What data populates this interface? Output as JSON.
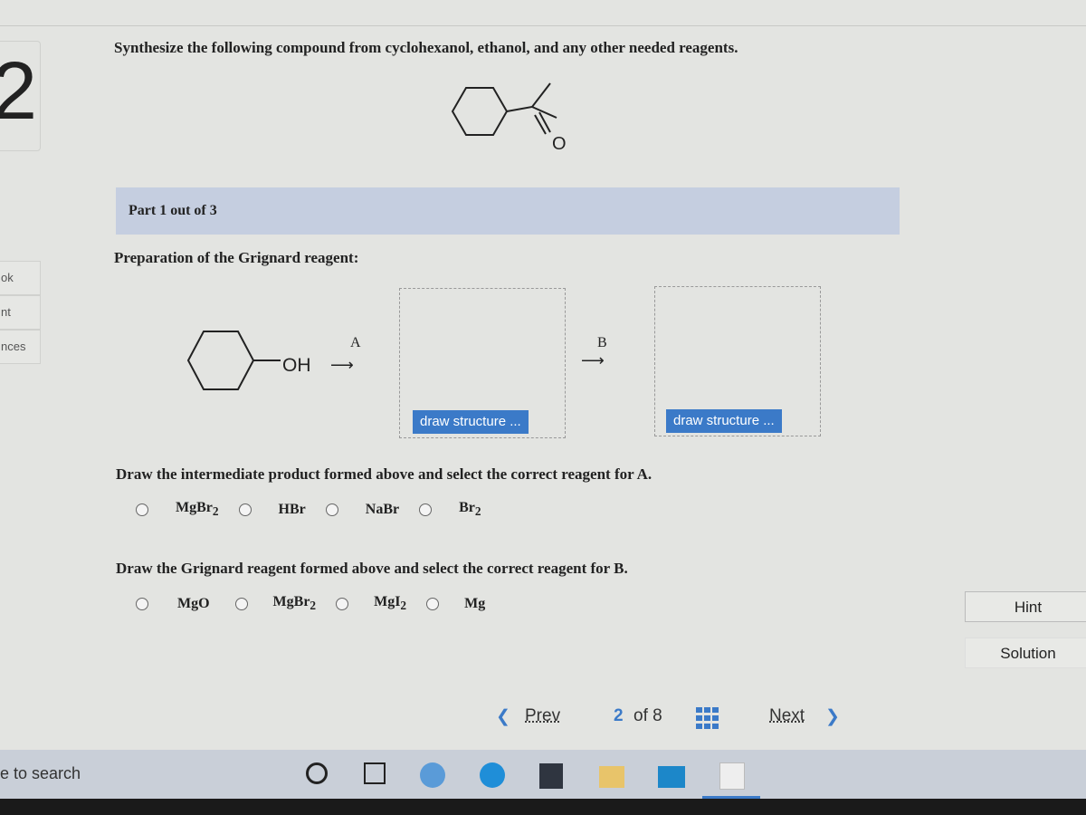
{
  "question": {
    "number": "2",
    "prompt": "Synthesize the following compound from cyclohexanol, ethanol, and any other needed reagents.",
    "target_atom_label": "O"
  },
  "sidebar": {
    "items": [
      {
        "label": "ok"
      },
      {
        "label": "nt"
      },
      {
        "label": "nces"
      }
    ]
  },
  "part": {
    "label": "Part 1 out of 3",
    "heading": "Preparation of the Grignard reagent:"
  },
  "scheme": {
    "start_group": "OH",
    "arrow_a": "A",
    "arrow_b": "B",
    "draw_button_1": "draw structure ...",
    "draw_button_2": "draw structure ..."
  },
  "q1": {
    "text": "Draw the intermediate product formed above and select the correct reagent for A.",
    "options": [
      {
        "main": "MgBr",
        "sub": "2"
      },
      {
        "main": "HBr",
        "sub": ""
      },
      {
        "main": "NaBr",
        "sub": ""
      },
      {
        "main": "Br",
        "sub": "2"
      }
    ]
  },
  "q2": {
    "text": "Draw the Grignard reagent formed above and select the correct reagent for B.",
    "options": [
      {
        "main": "MgO",
        "sub": ""
      },
      {
        "main": "MgBr",
        "sub": "2"
      },
      {
        "main": "MgI",
        "sub": "2"
      },
      {
        "main": "Mg",
        "sub": ""
      }
    ]
  },
  "side_buttons": {
    "hint": "Hint",
    "solution": "Solution"
  },
  "pager": {
    "prev": "Prev",
    "current": "2",
    "of": "of 8",
    "next": "Next"
  },
  "taskbar": {
    "search": "e to search"
  },
  "colors": {
    "accent": "#3b7ac8",
    "part_bar": "#c5cee0"
  }
}
